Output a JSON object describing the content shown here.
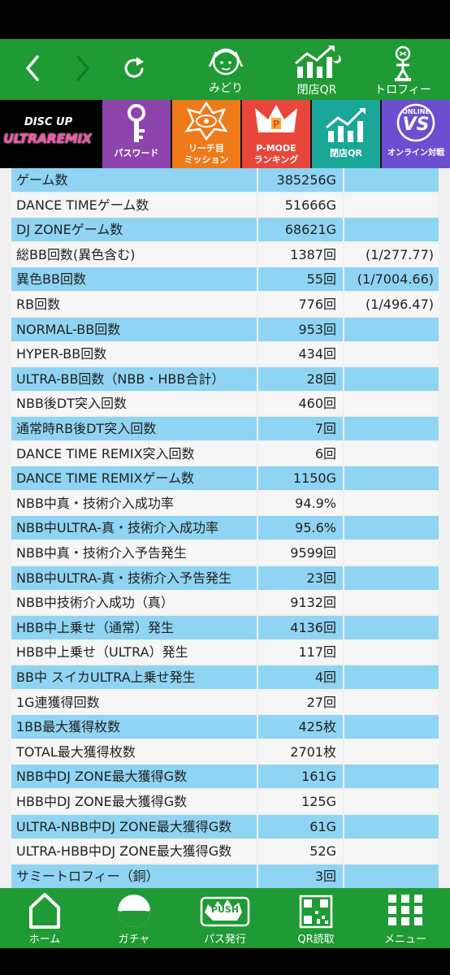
{
  "nav": {
    "midori_label": "みどり",
    "closing_qr_label": "閉店QR",
    "trophy_label": "トロフィー"
  },
  "menu": {
    "logo_line1": "DISC UP",
    "logo_line2": "ULTRAREMIX",
    "password_label": "パスワード",
    "reach_label_1": "リーチ目",
    "reach_label_2": "ミッション",
    "pmode_label_1": "P-MODE",
    "pmode_label_2": "ランキング",
    "closing_qr_label": "閉店QR",
    "online_badge": "ONLINE",
    "online_vs": "VS",
    "online_label": "オンライン対戦"
  },
  "stats": [
    {
      "label": "ゲーム数",
      "value": "385256G",
      "rate": ""
    },
    {
      "label": "DANCE TIMEゲーム数",
      "value": "51666G",
      "rate": ""
    },
    {
      "label": "DJ ZONEゲーム数",
      "value": "68621G",
      "rate": ""
    },
    {
      "label": "総BB回数(異色含む)",
      "value": "1387回",
      "rate": "(1/277.77)"
    },
    {
      "label": "異色BB回数",
      "value": "55回",
      "rate": "(1/7004.66)"
    },
    {
      "label": "RB回数",
      "value": "776回",
      "rate": "(1/496.47)"
    },
    {
      "label": "NORMAL-BB回数",
      "value": "953回",
      "rate": ""
    },
    {
      "label": "HYPER-BB回数",
      "value": "434回",
      "rate": ""
    },
    {
      "label": "ULTRA-BB回数（NBB・HBB合計）",
      "value": "28回",
      "rate": ""
    },
    {
      "label": "NBB後DT突入回数",
      "value": "460回",
      "rate": ""
    },
    {
      "label": "通常時RB後DT突入回数",
      "value": "7回",
      "rate": ""
    },
    {
      "label": "DANCE TIME REMIX突入回数",
      "value": "6回",
      "rate": ""
    },
    {
      "label": "DANCE TIME REMIXゲーム数",
      "value": "1150G",
      "rate": ""
    },
    {
      "label": "NBB中真・技術介入成功率",
      "value": "94.9%",
      "rate": ""
    },
    {
      "label": "NBB中ULTRA-真・技術介入成功率",
      "value": "95.6%",
      "rate": ""
    },
    {
      "label": "NBB中真・技術介入予告発生",
      "value": "9599回",
      "rate": ""
    },
    {
      "label": "NBB中ULTRA-真・技術介入予告発生",
      "value": "23回",
      "rate": ""
    },
    {
      "label": "NBB中技術介入成功（真）",
      "value": "9132回",
      "rate": ""
    },
    {
      "label": "HBB中上乗せ（通常）発生",
      "value": "4136回",
      "rate": ""
    },
    {
      "label": "HBB中上乗せ（ULTRA）発生",
      "value": "117回",
      "rate": ""
    },
    {
      "label": "BB中 スイカULTRA上乗せ発生",
      "value": "4回",
      "rate": ""
    },
    {
      "label": "1G連獲得回数",
      "value": "27回",
      "rate": ""
    },
    {
      "label": "1BB最大獲得枚数",
      "value": "425枚",
      "rate": ""
    },
    {
      "label": "TOTAL最大獲得枚数",
      "value": "2701枚",
      "rate": ""
    },
    {
      "label": "NBB中DJ ZONE最大獲得G数",
      "value": "161G",
      "rate": ""
    },
    {
      "label": "HBB中DJ ZONE最大獲得G数",
      "value": "125G",
      "rate": ""
    },
    {
      "label": "ULTRA-NBB中DJ ZONE最大獲得G数",
      "value": "61G",
      "rate": ""
    },
    {
      "label": "ULTRA-HBB中DJ ZONE最大獲得G数",
      "value": "52G",
      "rate": ""
    },
    {
      "label": "サミートロフィー（銅）",
      "value": "3回",
      "rate": ""
    }
  ],
  "bottom_nav": {
    "home": "ホーム",
    "gacha": "ガチャ",
    "push_icon_text": "PUSH",
    "pass": "パス発行",
    "qr_read": "QR読取",
    "menu": "メニュー"
  },
  "colors": {
    "nav_green": "#1f9a34",
    "row_blue": "#8fd4f2",
    "row_white": "#f6f6f6",
    "tile_purple": "#8e44ad",
    "tile_orange": "#f07a1a",
    "tile_red": "#e8463a",
    "tile_teal": "#1aa79a",
    "tile_violet": "#6c4fd0"
  }
}
